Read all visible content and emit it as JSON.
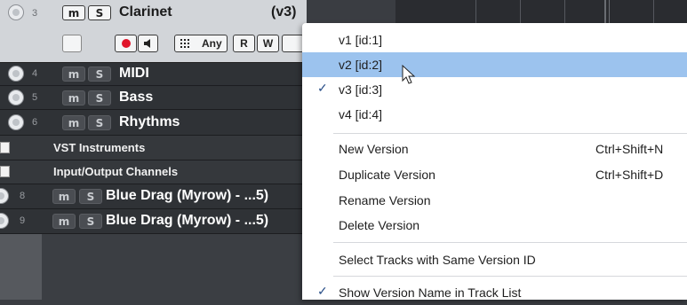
{
  "tracks": [
    {
      "number": "3",
      "mute": "m",
      "solo": "S",
      "name": "Clarinet",
      "version": "(v3)"
    },
    {
      "number": "4",
      "mute": "m",
      "solo": "S",
      "name": "MIDI"
    },
    {
      "number": "5",
      "mute": "m",
      "solo": "S",
      "name": "Bass"
    },
    {
      "number": "6",
      "mute": "m",
      "solo": "S",
      "name": "Rhythms"
    },
    {
      "number": "8",
      "mute": "m",
      "solo": "S",
      "name": "Blue Drag (Myrow) - ...5)"
    },
    {
      "number": "9",
      "mute": "m",
      "solo": "S",
      "name": "Blue Drag (Myrow) - ...5)"
    }
  ],
  "folders": [
    "VST Instruments",
    "Input/Output Channels"
  ],
  "clarinet_controls": {
    "input": "Any",
    "read": "R",
    "write": "W"
  },
  "menu": {
    "versions": [
      {
        "label": "v1 [id:1]",
        "checked": false,
        "highlighted": false
      },
      {
        "label": "v2 [id:2]",
        "checked": false,
        "highlighted": true
      },
      {
        "label": "v3 [id:3]",
        "checked": true,
        "highlighted": false
      },
      {
        "label": "v4 [id:4]",
        "checked": false,
        "highlighted": false
      }
    ],
    "actions": [
      {
        "label": "New Version",
        "shortcut": "Ctrl+Shift+N"
      },
      {
        "label": "Duplicate Version",
        "shortcut": "Ctrl+Shift+D"
      },
      {
        "label": "Rename Version",
        "shortcut": ""
      },
      {
        "label": "Delete Version",
        "shortcut": ""
      }
    ],
    "select_same_id": "Select Tracks with Same Version ID",
    "show_version_name": "Show Version Name in Track List",
    "check_mark": "✓"
  },
  "colors": {
    "highlight": "#9cc3ee",
    "record": "#e0142a",
    "track_bg": "#2f3236"
  }
}
